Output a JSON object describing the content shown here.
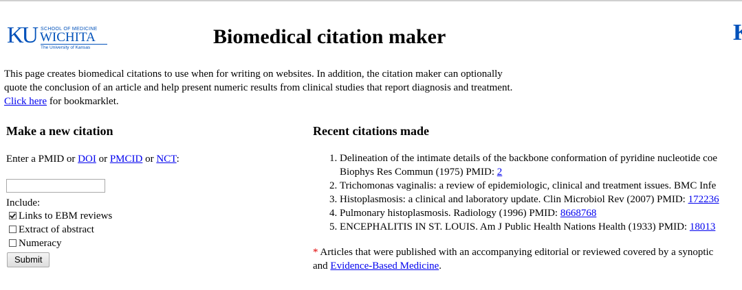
{
  "header": {
    "logo": {
      "initials": "KU",
      "school": "SCHOOL OF MEDICINE",
      "campus": "WICHITA",
      "university": "The University of Kansas"
    },
    "title": "Biomedical citation maker",
    "edge_logo": "K"
  },
  "intro": {
    "text_line1": "This page creates biomedical citations to use when for writing on websites. In addition, the citation maker can optionally",
    "text_line2": "quote the conclusion of an article and help present numeric results from clinical studies that report diagnosis and treatment.",
    "bookmarklet_link": "Click here",
    "bookmarklet_suffix": " for bookmarklet."
  },
  "form": {
    "heading": "Make a new citation",
    "enter_prefix": "Enter a PMID or ",
    "doi_link": "DOI",
    "or1": " or ",
    "pmcid_link": "PMCID",
    "or2": " or ",
    "nct_link": "NCT",
    "colon": ":",
    "input_value": "",
    "include_label": "Include:",
    "options": [
      {
        "label": "Links to EBM reviews",
        "checked": true
      },
      {
        "label": "Extract of abstract",
        "checked": false
      },
      {
        "label": "Numeracy",
        "checked": false
      }
    ],
    "submit_label": "Submit"
  },
  "recent": {
    "heading": "Recent citations made",
    "items": [
      {
        "text": "Delineation of the intimate details of the backbone conformation of pyridine nucleotide coe",
        "text2": "Biophys Res Commun (1975) PMID: ",
        "pmid": "2"
      },
      {
        "text": "Trichomonas vaginalis: a review of epidemiologic, clinical and treatment issues. BMC Infe",
        "pmid": ""
      },
      {
        "text": "Histoplasmosis: a clinical and laboratory update. Clin Microbiol Rev (2007) PMID: ",
        "pmid": "172236"
      },
      {
        "text": "Pulmonary histoplasmosis. Radiology (1996) PMID: ",
        "pmid": "8668768"
      },
      {
        "text": "ENCEPHALITIS IN ST. LOUIS. Am J Public Health Nations Health (1933) PMID: ",
        "pmid": "18013"
      }
    ]
  },
  "footnote": {
    "star": "*",
    "line1": " Articles that were published with an accompanying editorial or reviewed covered by a synoptic",
    "line2_prefix": "and ",
    "ebm_link": "Evidence-Based Medicine",
    "line2_suffix": "."
  },
  "colors": {
    "ku_blue": "#0051ba",
    "link": "#0000ee",
    "asterisk": "#e00000"
  }
}
